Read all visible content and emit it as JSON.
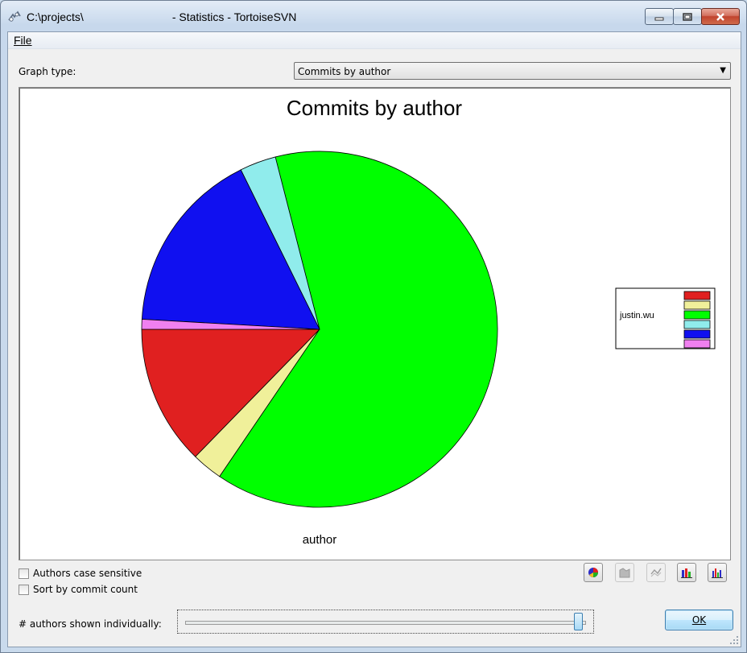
{
  "window": {
    "title_prefix": "C:\\projects\\",
    "title_suffix": "- Statistics - TortoiseSVN"
  },
  "menu": {
    "file_label": "File"
  },
  "graph_type": {
    "label": "Graph type:",
    "selected": "Commits by author"
  },
  "chart_data": {
    "type": "pie",
    "title": "Commits by author",
    "xlabel": "author",
    "slices": [
      {
        "name": "",
        "value": 12.7,
        "color": "#e02020"
      },
      {
        "name": "",
        "value": 2.8,
        "color": "#f0f09a"
      },
      {
        "name": "justin.wu",
        "value": 63.5,
        "color": "#00ff00"
      },
      {
        "name": "",
        "value": 3.3,
        "color": "#90ecec"
      },
      {
        "name": "",
        "value": 16.8,
        "color": "#1010f0"
      },
      {
        "name": "",
        "value": 0.9,
        "color": "#f080f0"
      }
    ],
    "legend_position": "right"
  },
  "options": {
    "case_sensitive_label": "Authors case sensitive",
    "sort_by_count_label": "Sort by commit count"
  },
  "authors_shown": {
    "label": "# authors shown individually:",
    "slider_fraction": 1.0
  },
  "buttons": {
    "ok_label": "OK"
  }
}
